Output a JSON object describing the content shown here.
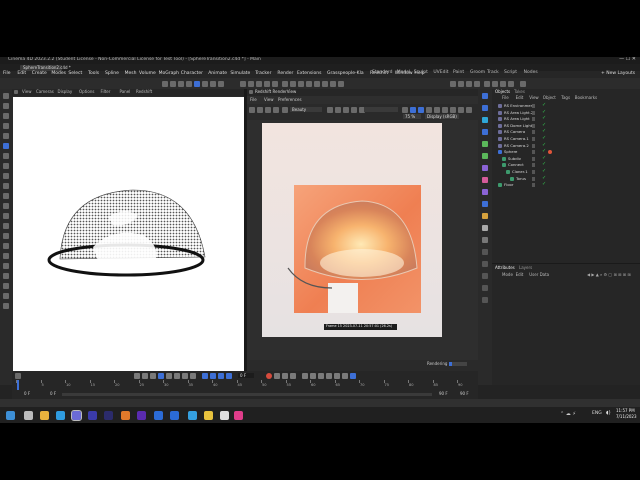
{
  "window": {
    "title": "Cinema 4D 2023.2.2 (Student License - Non-Commercial License for Test Tool) - [SphereTransition2.c4d *] - Main"
  },
  "file_tab": "SphereTransition2.c4d *",
  "menubar": [
    "File",
    "Edit",
    "Create",
    "Modes",
    "Select",
    "Tools",
    "Spline",
    "Mesh",
    "Volume",
    "MoGraph",
    "Character",
    "Animate",
    "Simulate",
    "Tracker",
    "Render",
    "Extensions",
    "Grasspeople-Kla",
    "Redshift",
    "Window",
    "Help"
  ],
  "layouts": [
    "Standard",
    "Model",
    "Sculpt",
    "UVEdit",
    "Paint",
    "Groom",
    "Track",
    "Script",
    "Nodes"
  ],
  "new_layouts": "+ New Layouts",
  "viewport_menu": [
    "View",
    "Cameras",
    "Display",
    "Options",
    "Filter",
    "Panel",
    "Redshift"
  ],
  "rv": {
    "title": "Redshift RenderView",
    "menu": [
      "File",
      "View",
      "Preferences"
    ],
    "beauty": "Beauty",
    "zoom": "75 %",
    "display": "Display (sRGB)",
    "frame_info": "Frame 15  2023-07-11  20:57:01  (26.2s)",
    "rendering_label": "Rendering",
    "progress": 0.15
  },
  "objects_tabs": [
    "Objects",
    "Takes"
  ],
  "objects_menu": [
    "File",
    "Edit",
    "View",
    "Object",
    "Tags",
    "Bookmarks"
  ],
  "objects": [
    "RS Environment",
    "RS Area Light.2",
    "RS Area Light",
    "RS Dome Light",
    "RS Camera",
    "RS Camera.1",
    "RS Camera.2",
    "Sphere",
    "Subdiv",
    "Connect",
    "Cloner.1",
    "Torus",
    "Floor"
  ],
  "attr_tabs": [
    "Attributes",
    "Layers"
  ],
  "attr_menu": [
    "Mode",
    "Edit",
    "User Data"
  ],
  "timeline": {
    "current": "0 F",
    "ticks": [
      "0",
      "5",
      "10",
      "15",
      "20",
      "25",
      "30",
      "35",
      "40",
      "45",
      "50",
      "55",
      "60",
      "65",
      "70",
      "75",
      "80",
      "85",
      "90"
    ],
    "range_start": "0 F",
    "range_start2": "0 F",
    "range_end": "90 F",
    "range_end2": "90 F",
    "frame_field": "0 F"
  },
  "taskbar": {
    "time": "11:57 PM",
    "date": "7/11/2023",
    "lang": "ENG",
    "icons": [
      "windows",
      "search",
      "chrome",
      "edge",
      "cinema4d",
      "after-effects",
      "media-encoder",
      "illustrator",
      "premiere",
      "lightroom",
      "photoshop",
      "telegram",
      "file-explorer",
      "notes",
      "aftercodecs"
    ]
  },
  "colors": {
    "accent": "#3d6fd6",
    "check": "#34c24f",
    "sphere_tag": "#e0553a",
    "render_bg": "#f08a5f"
  }
}
